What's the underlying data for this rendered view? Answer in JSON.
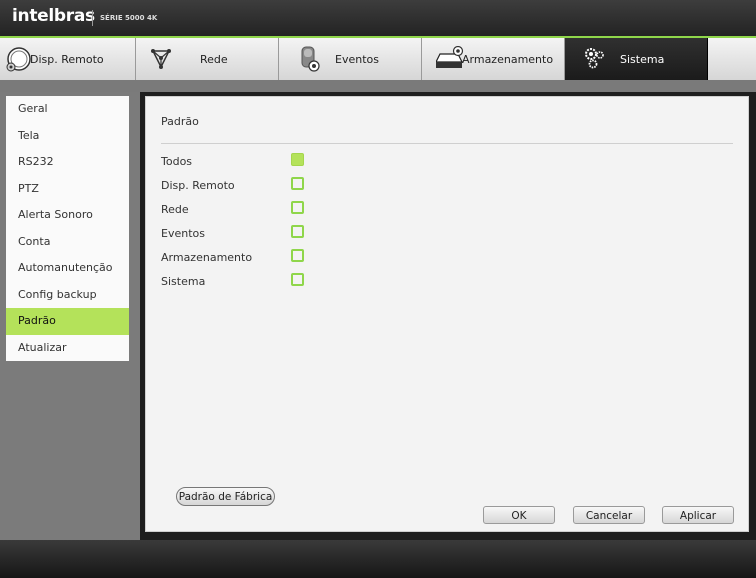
{
  "brand": {
    "logo": "intelbras",
    "series": "SÉRIE 5000 4K",
    "accent": "#8fd64a"
  },
  "tabs": [
    {
      "label": "Disp. Remoto",
      "icon": "remote-device-icon"
    },
    {
      "label": "Rede",
      "icon": "network-icon"
    },
    {
      "label": "Eventos",
      "icon": "events-icon"
    },
    {
      "label": "Armazenamento",
      "icon": "storage-icon"
    },
    {
      "label": "Sistema",
      "icon": "gears-icon",
      "active": true
    }
  ],
  "sidebar": {
    "items": [
      {
        "label": "Geral"
      },
      {
        "label": "Tela"
      },
      {
        "label": "RS232"
      },
      {
        "label": "PTZ"
      },
      {
        "label": "Alerta Sonoro"
      },
      {
        "label": "Conta"
      },
      {
        "label": "Automanutenção"
      },
      {
        "label": "Config backup"
      },
      {
        "label": "Padrão",
        "active": true
      },
      {
        "label": "Atualizar"
      }
    ]
  },
  "main": {
    "title": "Padrão",
    "options": [
      {
        "label": "Todos",
        "checked": true
      },
      {
        "label": "Disp. Remoto",
        "checked": false
      },
      {
        "label": "Rede",
        "checked": false
      },
      {
        "label": "Eventos",
        "checked": false
      },
      {
        "label": "Armazenamento",
        "checked": false
      },
      {
        "label": "Sistema",
        "checked": false
      }
    ],
    "factory_button": "Padrão de Fábrica",
    "ok_button": "OK",
    "cancel_button": "Cancelar",
    "apply_button": "Aplicar"
  }
}
